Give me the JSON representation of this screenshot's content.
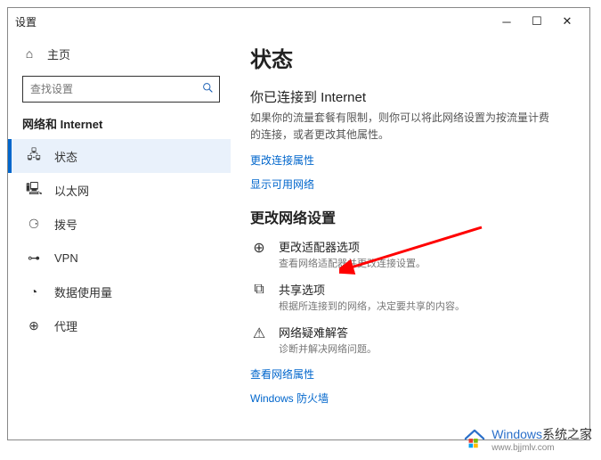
{
  "window": {
    "title": "设置"
  },
  "sidebar": {
    "home_label": "主页",
    "search_placeholder": "查找设置",
    "section": "网络和 Internet",
    "items": [
      {
        "icon": "status-icon",
        "glyph": "🖧",
        "label": "状态"
      },
      {
        "icon": "ethernet-icon",
        "glyph": "🖳",
        "label": "以太网"
      },
      {
        "icon": "dialup-icon",
        "glyph": "⚆",
        "label": "拨号"
      },
      {
        "icon": "vpn-icon",
        "glyph": "⊶",
        "label": "VPN"
      },
      {
        "icon": "datausage-icon",
        "glyph": "◔",
        "label": "数据使用量"
      },
      {
        "icon": "proxy-icon",
        "glyph": "⊕",
        "label": "代理"
      }
    ]
  },
  "main": {
    "heading": "状态",
    "connected_title": "你已连接到 Internet",
    "connected_desc": "如果你的流量套餐有限制，则你可以将此网络设置为按流量计费的连接，或者更改其他属性。",
    "link_change_conn": "更改连接属性",
    "link_show_networks": "显示可用网络",
    "change_settings_heading": "更改网络设置",
    "options": [
      {
        "icon": "adapter-icon",
        "glyph": "⊕",
        "title": "更改适配器选项",
        "desc": "查看网络适配器并更改连接设置。"
      },
      {
        "icon": "sharing-icon",
        "glyph": "⧉",
        "title": "共享选项",
        "desc": "根据所连接到的网络，决定要共享的内容。"
      },
      {
        "icon": "troubleshoot-icon",
        "glyph": "⚠",
        "title": "网络疑难解答",
        "desc": "诊断并解决网络问题。"
      }
    ],
    "link_props": "查看网络属性",
    "link_firewall": "Windows 防火墙"
  },
  "watermark": {
    "brand_main": "Windows",
    "brand_sub": "系统之家",
    "url": "www.bjjmlv.com"
  }
}
